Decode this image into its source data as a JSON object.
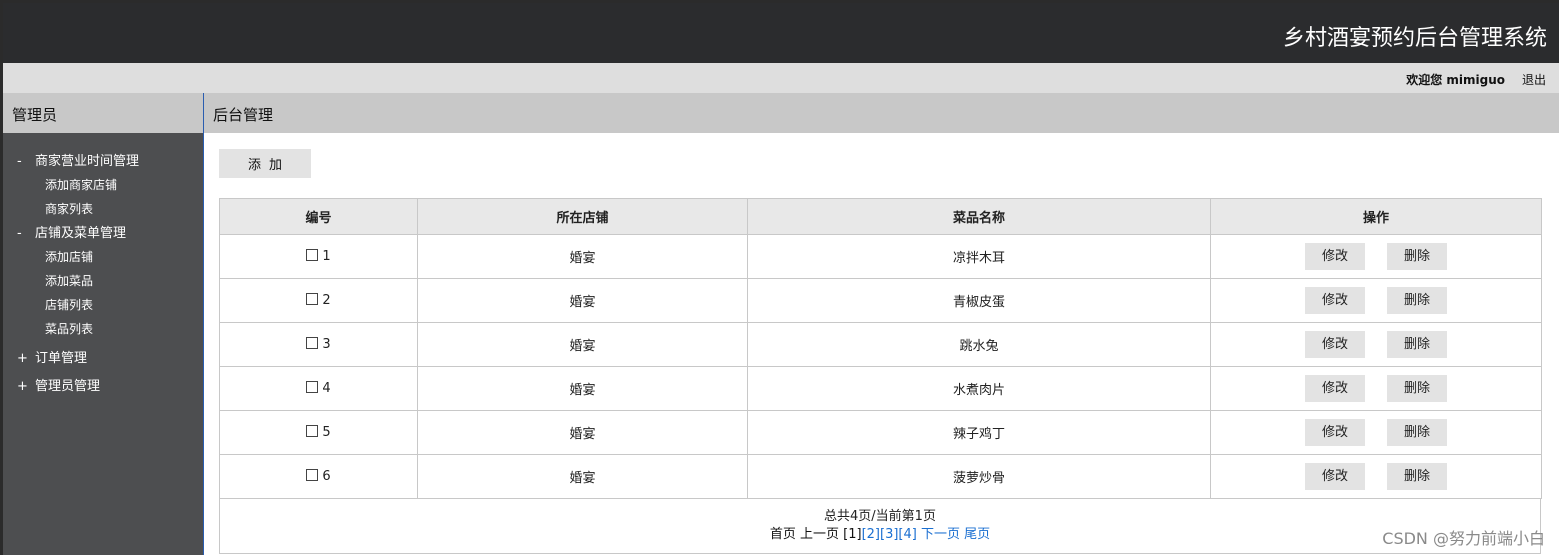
{
  "app": {
    "title": "乡村酒宴预约后台管理系统"
  },
  "userbar": {
    "welcome": "欢迎您 mimiguo",
    "logout": "退出"
  },
  "sidebar": {
    "heading": "管理员",
    "groups": [
      {
        "sign": "-",
        "label": "商家营业时间管理",
        "items": [
          "添加商家店铺",
          "商家列表"
        ]
      },
      {
        "sign": "-",
        "label": "店铺及菜单管理",
        "items": [
          "添加店铺",
          "添加菜品",
          "店铺列表",
          "菜品列表"
        ]
      },
      {
        "sign": "+",
        "label": "订单管理",
        "items": []
      },
      {
        "sign": "+",
        "label": "管理员管理",
        "items": []
      }
    ]
  },
  "main": {
    "heading": "后台管理",
    "add_label": "添加",
    "columns": [
      "编号",
      "所在店铺",
      "菜品名称",
      "操作"
    ],
    "rows": [
      {
        "id": "1",
        "shop": "婚宴",
        "dish": "凉拌木耳"
      },
      {
        "id": "2",
        "shop": "婚宴",
        "dish": "青椒皮蛋"
      },
      {
        "id": "3",
        "shop": "婚宴",
        "dish": "跳水兔"
      },
      {
        "id": "4",
        "shop": "婚宴",
        "dish": "水煮肉片"
      },
      {
        "id": "5",
        "shop": "婚宴",
        "dish": "辣子鸡丁"
      },
      {
        "id": "6",
        "shop": "婚宴",
        "dish": "菠萝炒骨"
      }
    ],
    "edit_label": "修改",
    "delete_label": "删除"
  },
  "pager": {
    "summary": "总共4页/当前第1页",
    "first": "首页",
    "prev": "上一页",
    "current": "[1]",
    "pages": [
      "[2]",
      "[3]",
      "[4]"
    ],
    "next": "下一页",
    "last": "尾页"
  },
  "watermark": "CSDN @努力前端小白",
  "colors": {
    "header_bg": "#2b2c2e",
    "sidebar_bg": "#4d4e50",
    "link": "#1a6fd1"
  }
}
